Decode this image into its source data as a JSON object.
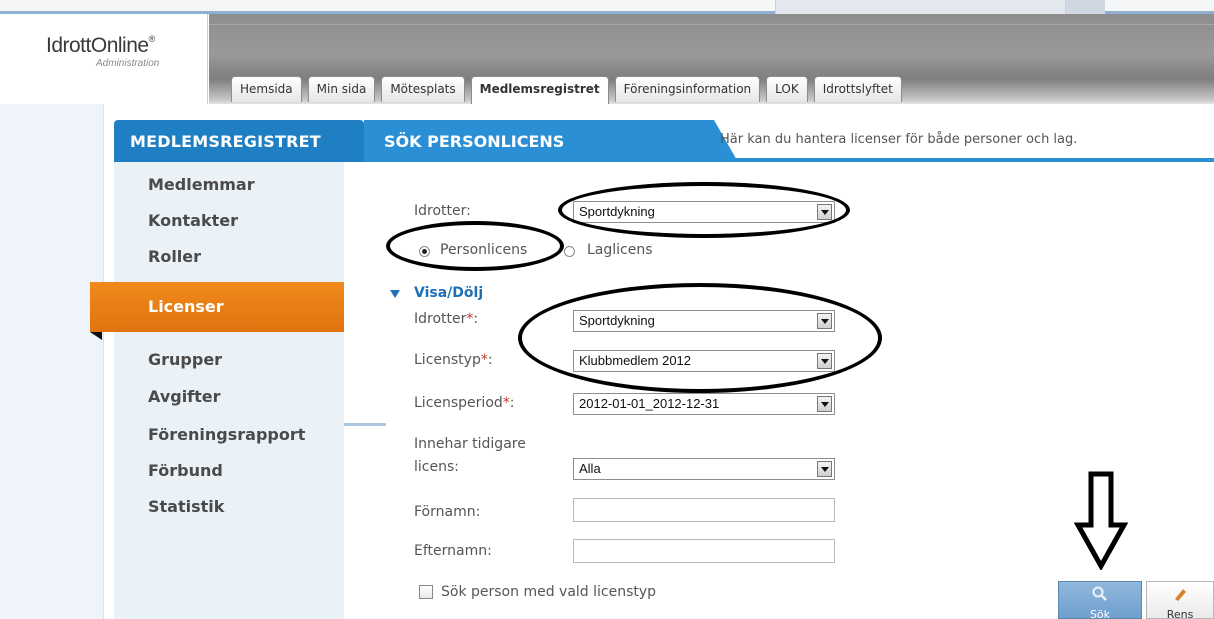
{
  "logo": {
    "main": "IdrottOnline",
    "reg": "®",
    "sub": "Administration"
  },
  "tabs": [
    "Hemsida",
    "Min sida",
    "Mötesplats",
    "Medlemsregistret",
    "Föreningsinformation",
    "LOK",
    "Idrottslyftet"
  ],
  "active_tab": "Medlemsregistret",
  "section": {
    "left_title": "MEDLEMSREGISTRET",
    "page_title": "SÖK PERSONLICENS",
    "description": "Här kan du hantera licenser för både personer och lag."
  },
  "nav": {
    "items": [
      "Medlemmar",
      "Kontakter",
      "Roller",
      "Licenser",
      "Grupper",
      "Avgifter",
      "Föreningsrapport",
      "Förbund",
      "Statistik"
    ],
    "active": "Licenser"
  },
  "form": {
    "idrotter_top": {
      "label": "Idrotter:",
      "value": "Sportdykning"
    },
    "license_kind": {
      "option1": "Personlicens",
      "option2": "Laglicens",
      "selected": "Personlicens"
    },
    "toggle": "Visa/Dölj",
    "idrotter": {
      "label": "Idrotter",
      "value": "Sportdykning"
    },
    "licenstyp": {
      "label": "Licenstyp",
      "value": "Klubbmedlem 2012"
    },
    "licensperiod": {
      "label": "Licensperiod",
      "value": "2012-01-01_2012-12-31"
    },
    "innehar": {
      "label_line1": "Innehar tidigare",
      "label_line2": "licens:",
      "value": "Alla"
    },
    "fornamn": {
      "label": "Förnamn:",
      "value": ""
    },
    "efternamn": {
      "label": "Efternamn:",
      "value": ""
    },
    "checkbox_label": "Sök person med vald licenstyp",
    "required_mark": "*",
    "colon": ":"
  },
  "buttons": {
    "search": "Sök",
    "clear": "Rens"
  },
  "colors": {
    "accent_blue": "#2b8fd6",
    "nav_active": "#f08a1c"
  }
}
